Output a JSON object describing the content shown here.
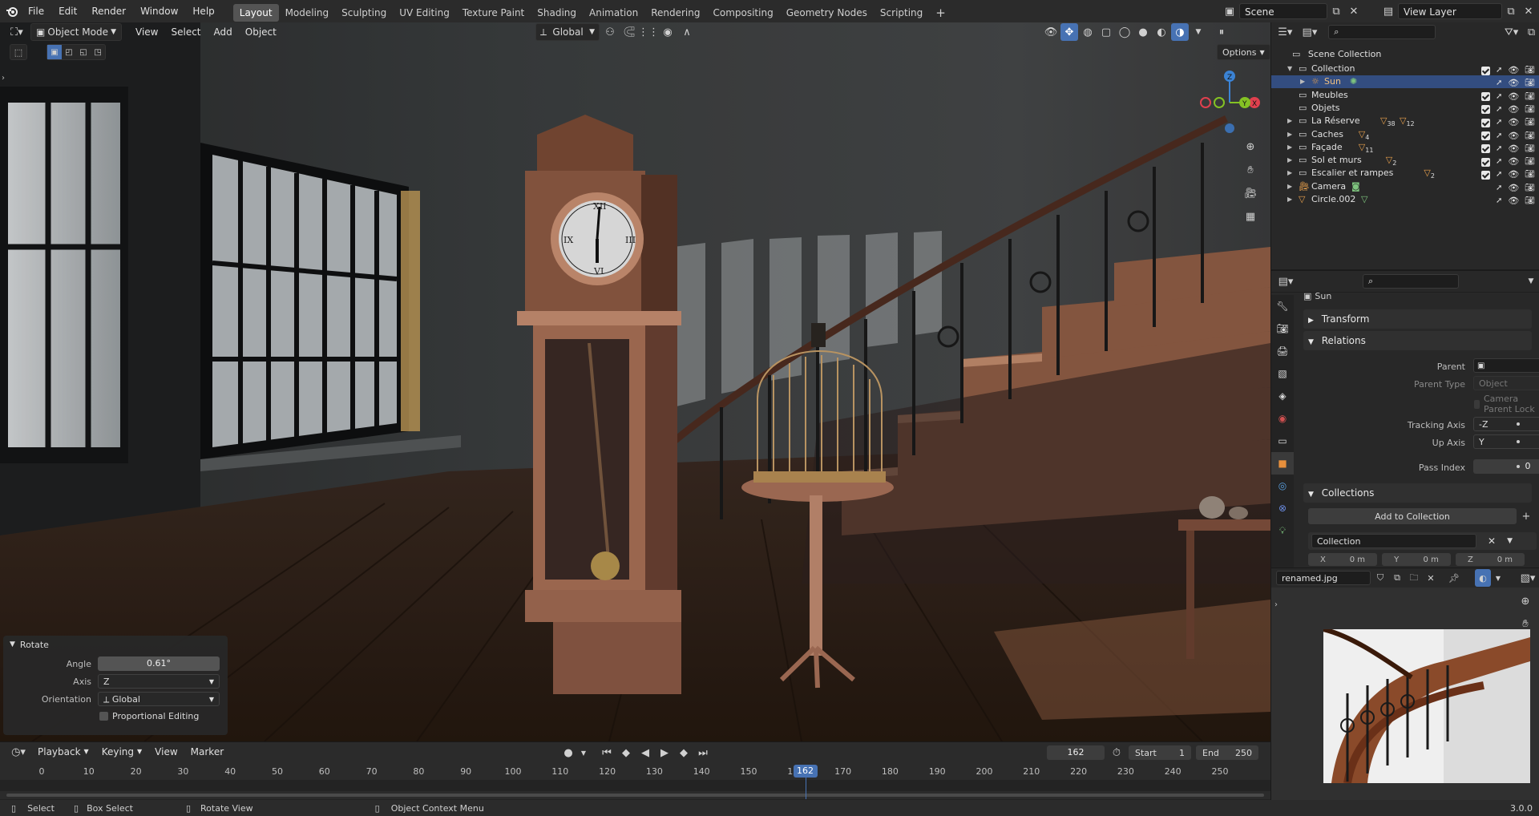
{
  "top_menu": {
    "items": [
      "File",
      "Edit",
      "Render",
      "Window",
      "Help"
    ],
    "workspaces": [
      "Layout",
      "Modeling",
      "Sculpting",
      "UV Editing",
      "Texture Paint",
      "Shading",
      "Animation",
      "Rendering",
      "Compositing",
      "Geometry Nodes",
      "Scripting"
    ],
    "active_workspace": "Layout",
    "add_tab": "+",
    "scene_name": "Scene",
    "view_layer": "View Layer"
  },
  "viewport_header": {
    "mode": "Object Mode",
    "menus": [
      "View",
      "Select",
      "Add",
      "Object"
    ],
    "transform_orientation": "Global",
    "options_label": "Options"
  },
  "gizmo": {
    "z": "Z",
    "y": "Y",
    "x": "X"
  },
  "rotate_panel": {
    "title": "Rotate",
    "angle_label": "Angle",
    "angle_value": "0.61°",
    "axis_label": "Axis",
    "axis_value": "Z",
    "orientation_label": "Orientation",
    "orientation_value": "Global",
    "proportional_label": "Proportional Editing"
  },
  "timeline": {
    "menus": [
      "Playback",
      "Keying",
      "View",
      "Marker"
    ],
    "current_frame": "162",
    "start_label": "Start",
    "start_value": "1",
    "end_label": "End",
    "end_value": "250",
    "ticks": [
      0,
      10,
      20,
      30,
      40,
      50,
      60,
      70,
      80,
      90,
      100,
      110,
      120,
      130,
      140,
      150,
      160,
      170,
      180,
      190,
      200,
      210,
      220,
      230,
      240,
      250
    ],
    "playhead_label": "162"
  },
  "status_bar": {
    "select": "Select",
    "box_select": "Box Select",
    "rotate_view": "Rotate View",
    "context_menu": "Object Context Menu",
    "version": "3.0.0"
  },
  "outliner": {
    "root": "Scene Collection",
    "rows": [
      {
        "name": "Collection",
        "level": 1,
        "expanded": true,
        "kind": "collection"
      },
      {
        "name": "Sun",
        "level": 2,
        "kind": "light",
        "selected": true
      },
      {
        "name": "Meubles",
        "level": 1,
        "kind": "collection"
      },
      {
        "name": "Objets",
        "level": 1,
        "kind": "collection"
      },
      {
        "name": "La Réserve",
        "level": 1,
        "kind": "collection",
        "badges": [
          "38",
          "12"
        ]
      },
      {
        "name": "Caches",
        "level": 1,
        "kind": "collection",
        "badges": [
          "4"
        ]
      },
      {
        "name": "Façade",
        "level": 1,
        "kind": "collection",
        "badges": [
          "11"
        ]
      },
      {
        "name": "Sol et murs",
        "level": 1,
        "kind": "collection",
        "badges": [
          "2"
        ]
      },
      {
        "name": "Escalier et rampes",
        "level": 1,
        "kind": "collection",
        "badges": [
          "2"
        ]
      },
      {
        "name": "Camera",
        "level": 1,
        "kind": "camera"
      },
      {
        "name": "Circle.002",
        "level": 1,
        "kind": "mesh"
      }
    ]
  },
  "properties": {
    "object_name": "Sun",
    "transform_section": "Transform",
    "relations_section": "Relations",
    "parent_label": "Parent",
    "parent_type_label": "Parent Type",
    "parent_type_value": "Object",
    "camera_parent_lock": "Camera Parent Lock",
    "tracking_axis_label": "Tracking Axis",
    "tracking_axis_value": "-Z",
    "up_axis_label": "Up Axis",
    "up_axis_value": "Y",
    "pass_index_label": "Pass Index",
    "pass_index_value": "0",
    "collections_section": "Collections",
    "add_to_collection": "Add to Collection",
    "collection_name": "Collection",
    "offset_x": "X",
    "offset_x_value": "0 m",
    "offset_y": "Y",
    "offset_y_value": "0 m",
    "offset_z": "Z",
    "offset_z_value": "0 m"
  },
  "image_editor": {
    "image_name": "renamed.jpg"
  },
  "colors": {
    "accent_blue": "#4772b3",
    "selected_row": "#334d80",
    "light_orange": "#e8a04c",
    "mesh_green": "#7ec47e",
    "axis_x": "#e0404e",
    "axis_y": "#84c224",
    "axis_z": "#3b83d4"
  }
}
